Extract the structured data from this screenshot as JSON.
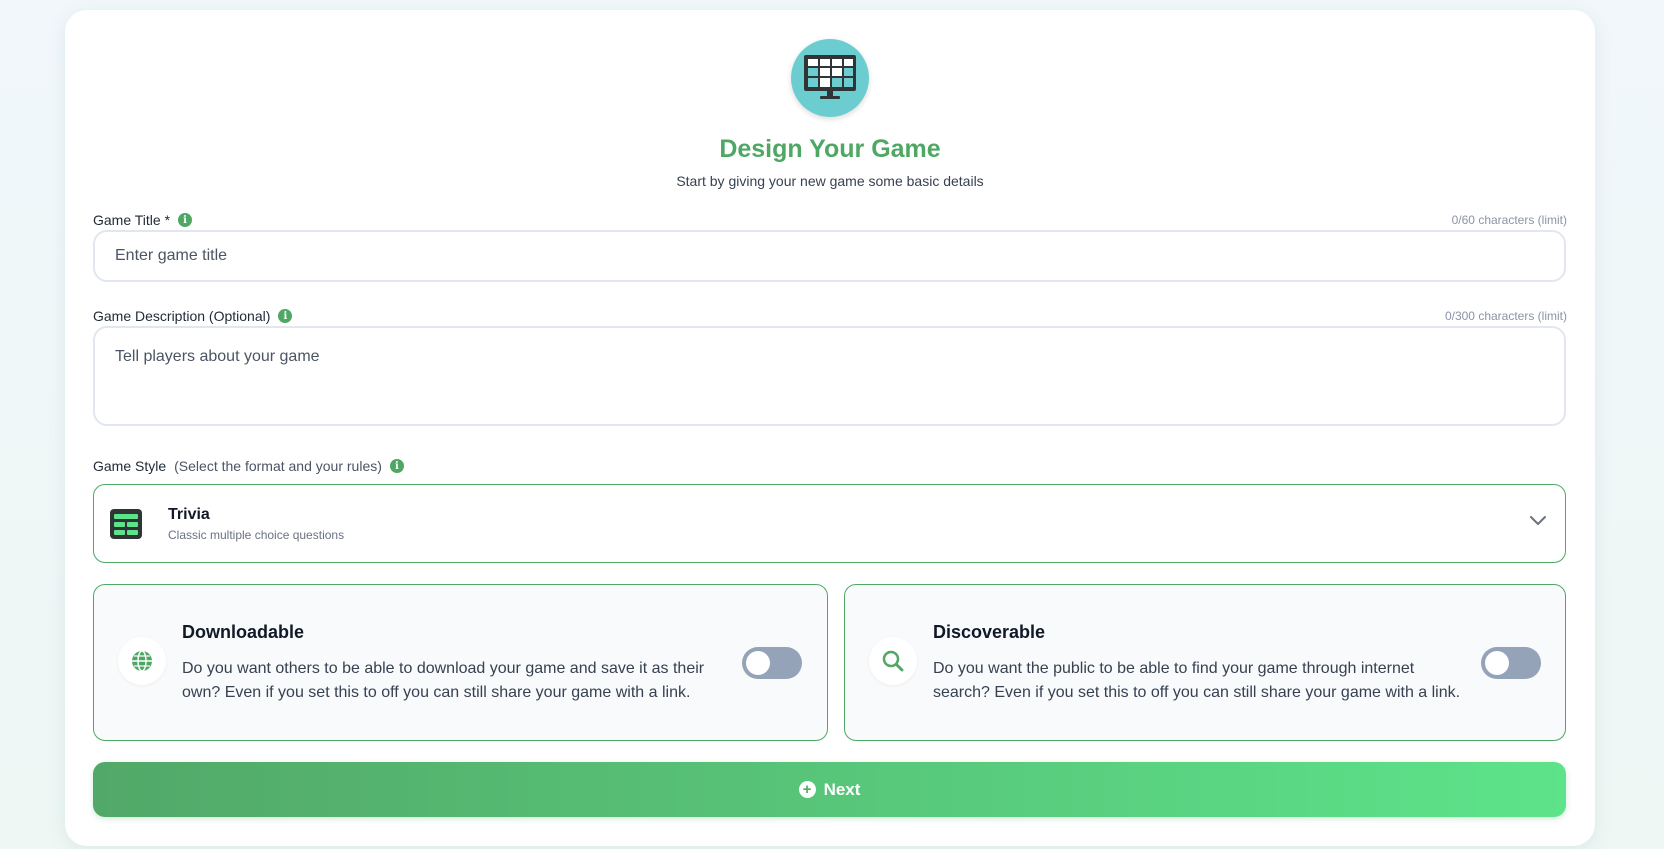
{
  "header": {
    "icon": "monitor-grid-icon",
    "title": "Design Your Game",
    "subtitle": "Start by giving your new game some basic details"
  },
  "game_title": {
    "label": "Game Title *",
    "counter": "0/60 characters (limit)",
    "placeholder": "Enter game title"
  },
  "game_description": {
    "label": "Game Description (Optional)",
    "counter": "0/300 characters (limit)",
    "placeholder": "Tell players about your game"
  },
  "game_style": {
    "label": "Game Style",
    "hint": "(Select the format and your rules)",
    "selected_name": "Trivia",
    "selected_desc": "Classic multiple choice questions",
    "icon": "table-grid-icon"
  },
  "options": {
    "downloadable": {
      "title": "Downloadable",
      "description": "Do you want others to be able to download your game and save it as their own? Even if you set this to off you can still share your game with a link.",
      "enabled": false,
      "icon": "globe-icon"
    },
    "discoverable": {
      "title": "Discoverable",
      "description": "Do you want the public to be able to find your game through internet search? Even if you set this to off you can still share your game with a link.",
      "enabled": false,
      "icon": "search-icon"
    }
  },
  "next_button": {
    "label": "Next",
    "icon": "plus-circle-icon"
  },
  "colors": {
    "accent": "#4fa764",
    "logo_bg": "#6ccdd1",
    "toggle_off": "#94a3b8",
    "button_gradient_start": "#52a868",
    "button_gradient_end": "#5de38a"
  }
}
